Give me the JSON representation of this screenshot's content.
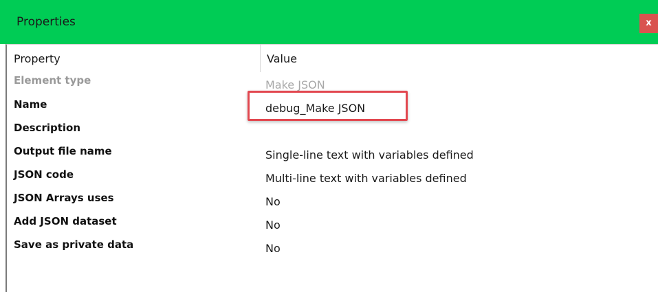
{
  "window": {
    "title": "Properties",
    "close_label": "x"
  },
  "table": {
    "header_property": "Property",
    "header_value": "Value",
    "rows": [
      {
        "property": "Element type",
        "value": "Make JSON"
      },
      {
        "property": "Name",
        "value": "debug_Make JSON"
      },
      {
        "property": "Description",
        "value": ""
      },
      {
        "property": "Output file name",
        "value": "Single-line text with variables defined"
      },
      {
        "property": "JSON code",
        "value": "Multi-line text with variables defined"
      },
      {
        "property": "JSON Arrays uses",
        "value": "No"
      },
      {
        "property": "Add JSON dataset",
        "value": "No"
      },
      {
        "property": "Save as private data",
        "value": "No"
      }
    ]
  },
  "colors": {
    "titlebar": "#00cc55",
    "close_button": "#d9534f",
    "highlight_border": "#e2474f",
    "disabled_text": "#9a9a9a"
  }
}
